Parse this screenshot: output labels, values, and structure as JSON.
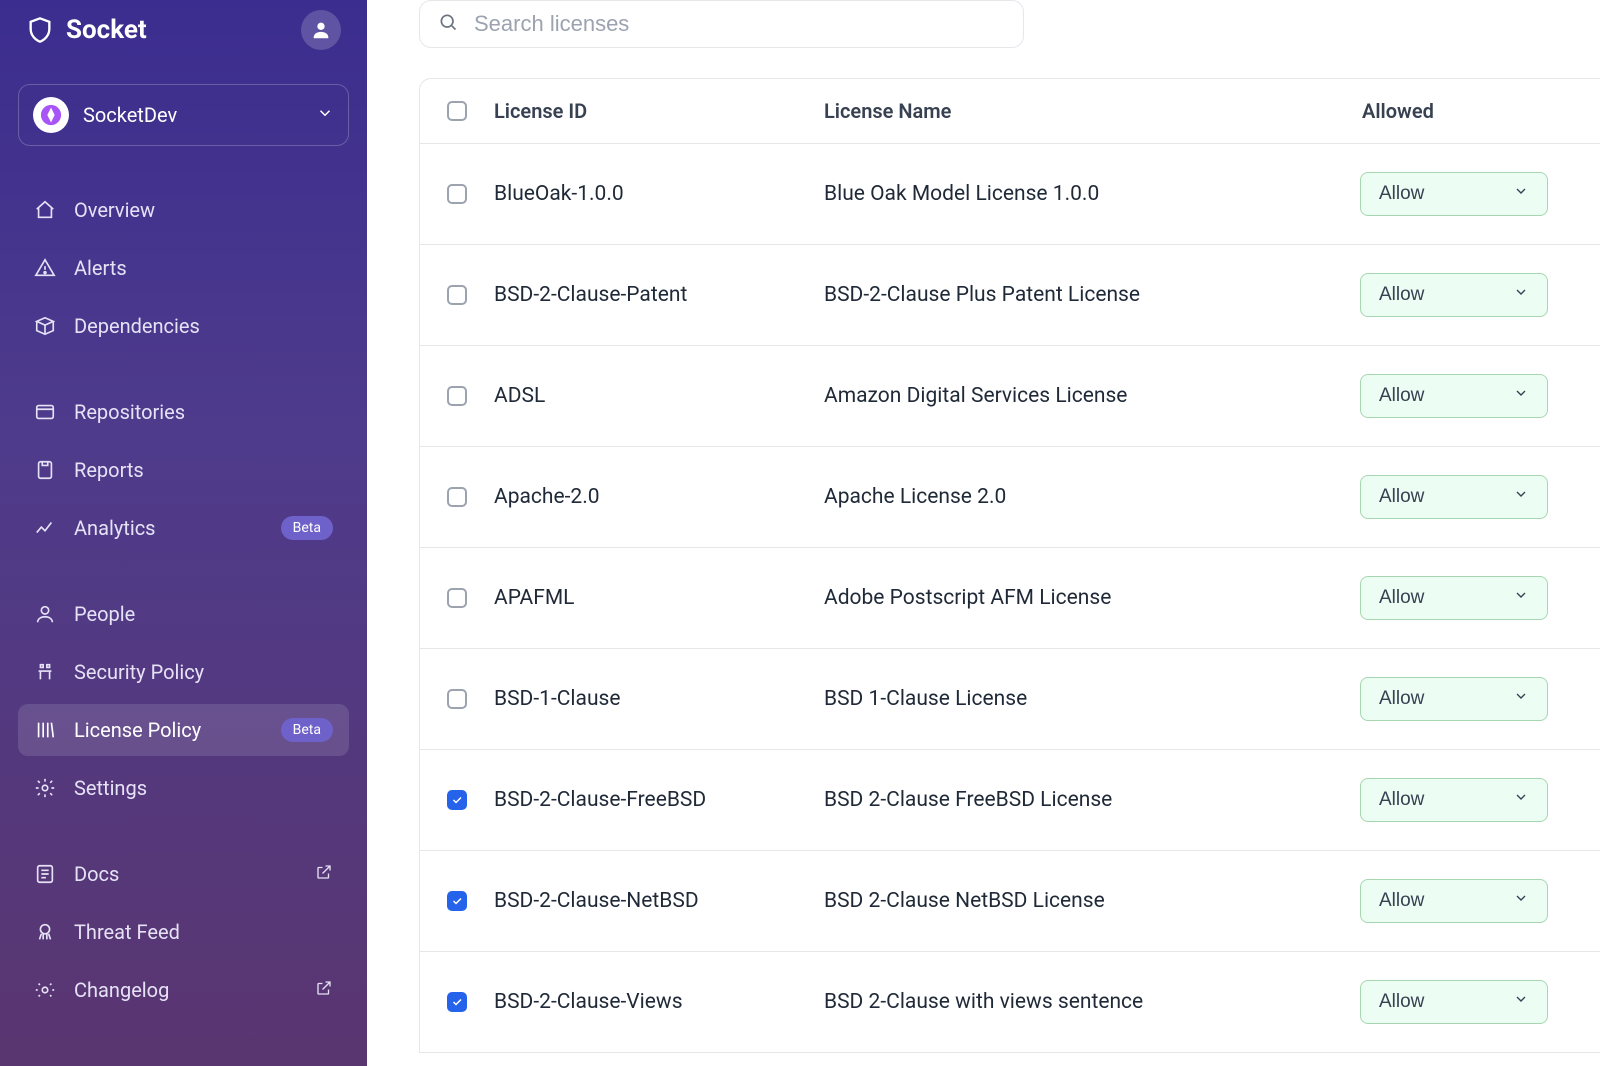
{
  "brand": {
    "name": "Socket"
  },
  "org": {
    "name": "SocketDev"
  },
  "sidebar": {
    "items": [
      {
        "label": "Overview",
        "icon": "home-icon"
      },
      {
        "label": "Alerts",
        "icon": "alert-icon"
      },
      {
        "label": "Dependencies",
        "icon": "box-icon"
      },
      {
        "label": "Repositories",
        "icon": "repo-icon"
      },
      {
        "label": "Reports",
        "icon": "reports-icon"
      },
      {
        "label": "Analytics",
        "icon": "analytics-icon",
        "badge": "Beta"
      },
      {
        "label": "People",
        "icon": "people-icon"
      },
      {
        "label": "Security Policy",
        "icon": "security-policy-icon"
      },
      {
        "label": "License Policy",
        "icon": "license-policy-icon",
        "badge": "Beta",
        "active": true
      },
      {
        "label": "Settings",
        "icon": "settings-icon"
      },
      {
        "label": "Docs",
        "icon": "docs-icon",
        "external": true
      },
      {
        "label": "Threat Feed",
        "icon": "threat-icon"
      },
      {
        "label": "Changelog",
        "icon": "changelog-icon",
        "external": true
      }
    ]
  },
  "search": {
    "placeholder": "Search licenses"
  },
  "table": {
    "headers": {
      "id": "License ID",
      "name": "License Name",
      "allowed": "Allowed"
    },
    "allow_label": "Allow",
    "rows": [
      {
        "checked": false,
        "id": "BlueOak-1.0.0",
        "name": "Blue Oak Model License 1.0.0"
      },
      {
        "checked": false,
        "id": "BSD-2-Clause-Patent",
        "name": "BSD-2-Clause Plus Patent License"
      },
      {
        "checked": false,
        "id": "ADSL",
        "name": "Amazon Digital Services License"
      },
      {
        "checked": false,
        "id": "Apache-2.0",
        "name": "Apache License 2.0"
      },
      {
        "checked": false,
        "id": "APAFML",
        "name": "Adobe Postscript AFM License"
      },
      {
        "checked": false,
        "id": "BSD-1-Clause",
        "name": "BSD 1-Clause License"
      },
      {
        "checked": true,
        "id": "BSD-2-Clause-FreeBSD",
        "name": "BSD 2-Clause FreeBSD License"
      },
      {
        "checked": true,
        "id": "BSD-2-Clause-NetBSD",
        "name": "BSD 2-Clause NetBSD License"
      },
      {
        "checked": true,
        "id": "BSD-2-Clause-Views",
        "name": "BSD 2-Clause with views sentence"
      }
    ]
  }
}
